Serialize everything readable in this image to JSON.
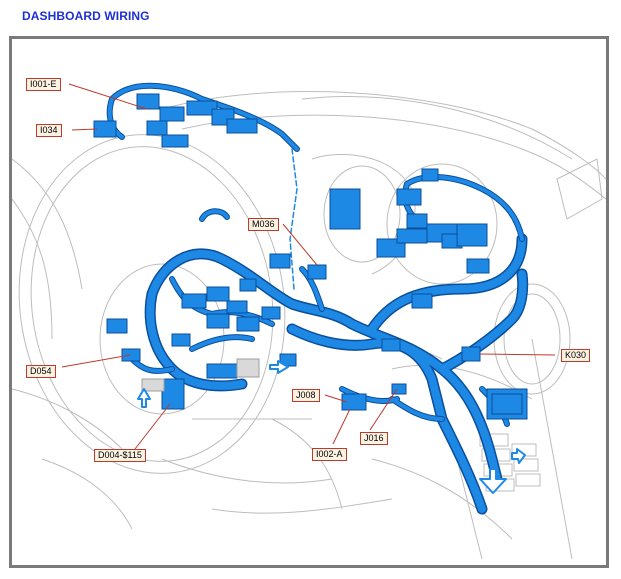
{
  "page": {
    "title": "DASHBOARD WIRING"
  },
  "callouts": [
    {
      "id": "i001e",
      "text": "I001-E"
    },
    {
      "id": "i034",
      "text": "I034"
    },
    {
      "id": "m036",
      "text": "M036"
    },
    {
      "id": "d054",
      "text": "D054"
    },
    {
      "id": "j008",
      "text": "J008"
    },
    {
      "id": "j016",
      "text": "J016"
    },
    {
      "id": "i002a",
      "text": "I002-A"
    },
    {
      "id": "d004",
      "text": "D004-$115"
    },
    {
      "id": "k030",
      "text": "K030"
    }
  ],
  "colors": {
    "title": "#1f2fd6",
    "harness": "#1e88e5",
    "harness_dark": "#0b4f9c",
    "leader_line": "#c0392b",
    "callout_fill": "#fdf3e3",
    "frame_border": "#7a7a7a",
    "outline": "#b5b5b5"
  }
}
